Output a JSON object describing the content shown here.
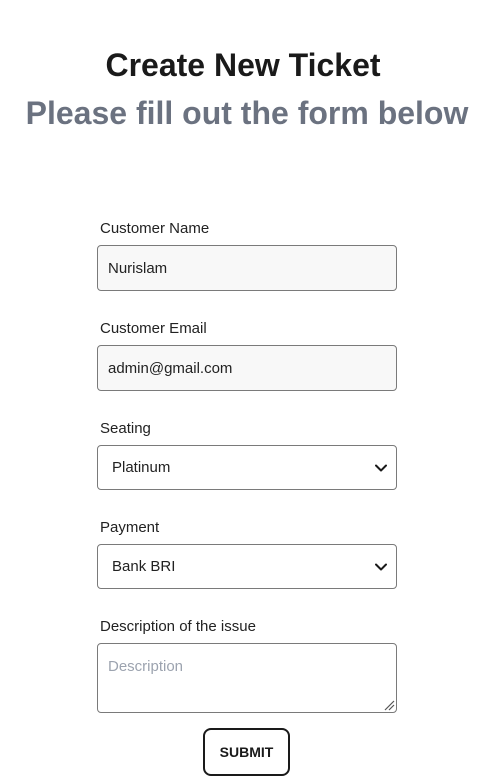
{
  "header": {
    "title": "Create New Ticket",
    "subtitle": "Please fill out the form below"
  },
  "form": {
    "customer_name": {
      "label": "Customer Name",
      "value": "Nurislam"
    },
    "customer_email": {
      "label": "Customer Email",
      "value": "admin@gmail.com"
    },
    "seating": {
      "label": "Seating",
      "selected": "Platinum",
      "icon": "chevron-down-icon"
    },
    "payment": {
      "label": "Payment",
      "selected": "Bank BRI",
      "icon": "chevron-down-icon"
    },
    "description": {
      "label": "Description of the issue",
      "placeholder": "Description",
      "value": ""
    },
    "submit_label": "SUBMIT"
  },
  "colors": {
    "title": "#1a1a1a",
    "subtitle": "#6b7280",
    "border": "#7a7a7a",
    "input_bg": "#f8f8f8"
  }
}
